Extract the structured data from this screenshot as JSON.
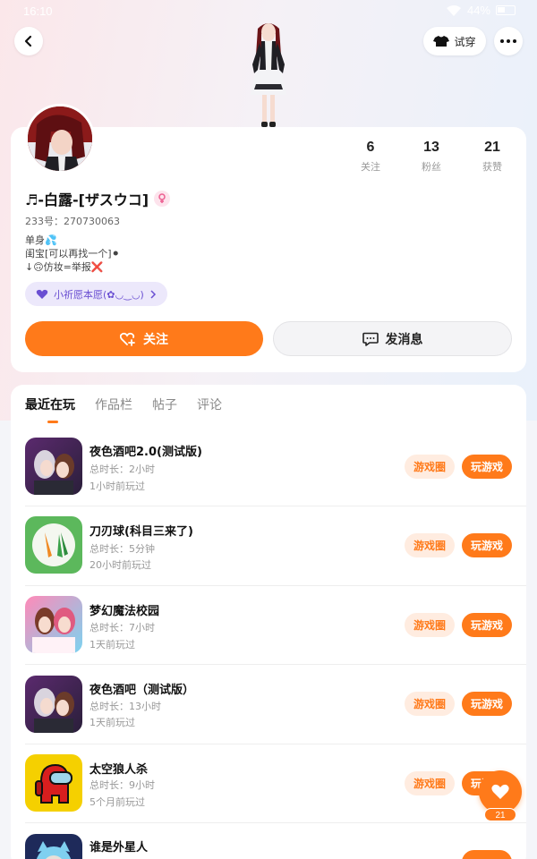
{
  "status_bar": {
    "time": "16:10",
    "battery": "44%"
  },
  "header": {
    "try_on_label": "试穿"
  },
  "profile": {
    "nickname": "♬-白露-[ザスウコ]",
    "uid": "233号：270730063",
    "bio_lines": [
      "单身💦",
      "闺宝[可以再找一个]⚫",
      "↓🙃仿妆=举报❌"
    ],
    "wish_label": "小祈愿本愿(✿◡‿◡)"
  },
  "stats": [
    {
      "value": "6",
      "label": "关注"
    },
    {
      "value": "13",
      "label": "粉丝"
    },
    {
      "value": "21",
      "label": "获赞"
    }
  ],
  "actions": {
    "follow_label": "关注",
    "message_label": "发消息"
  },
  "tabs": [
    {
      "label": "最近在玩",
      "active": true
    },
    {
      "label": "作品栏",
      "active": false
    },
    {
      "label": "帖子",
      "active": false
    },
    {
      "label": "评论",
      "active": false
    }
  ],
  "games": [
    {
      "title": "夜色酒吧2.0(测试版)",
      "duration": "总时长：2小时",
      "last_played": "1小时前玩过",
      "circle_label": "游戏圈",
      "play_label": "玩游戏"
    },
    {
      "title": "刀刃球(科目三来了)",
      "duration": "总时长：5分钟",
      "last_played": "20小时前玩过",
      "circle_label": "游戏圈",
      "play_label": "玩游戏"
    },
    {
      "title": "梦幻魔法校园",
      "duration": "总时长：7小时",
      "last_played": "1天前玩过",
      "circle_label": "游戏圈",
      "play_label": "玩游戏"
    },
    {
      "title": "夜色酒吧（测试版）",
      "duration": "总时长：13小时",
      "last_played": "1天前玩过",
      "circle_label": "游戏圈",
      "play_label": "玩游戏"
    },
    {
      "title": "太空狼人杀",
      "duration": "总时长：9小时",
      "last_played": "5个月前玩过",
      "circle_label": "游戏圈",
      "play_label": "玩游戏"
    },
    {
      "title": "谁是外星人",
      "duration": "",
      "last_played": "",
      "circle_label": "",
      "play_label": ""
    }
  ],
  "like_fab": {
    "count": "21"
  },
  "colors": {
    "accent": "#ff7a1a",
    "accent_light": "#ffece0",
    "wish_chip_bg": "#ece8fb"
  }
}
